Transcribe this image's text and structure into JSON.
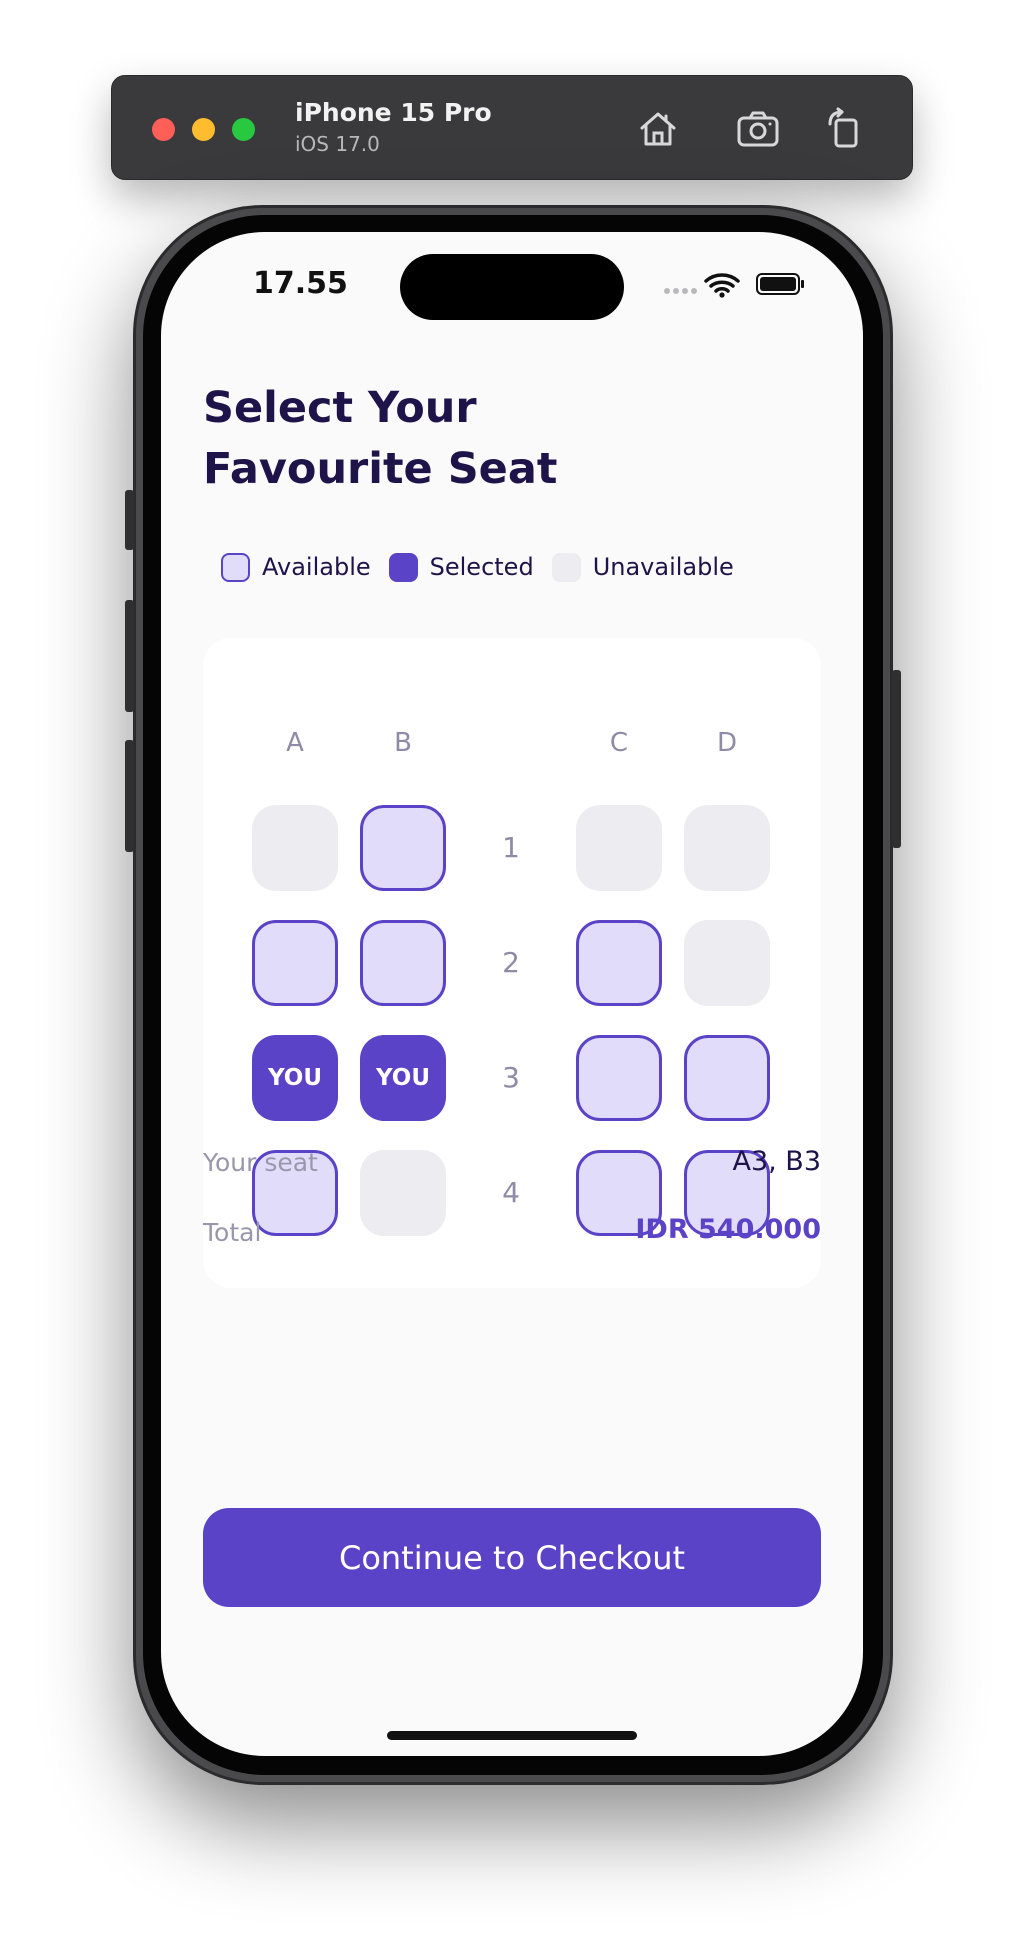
{
  "simulator": {
    "device_name": "iPhone 15 Pro",
    "os_version": "iOS 17.0",
    "buttons": [
      "home-icon",
      "screenshot-icon",
      "rotate-icon"
    ]
  },
  "status_bar": {
    "time": "17.55",
    "icons": [
      "cellular-dots-icon",
      "wifi-icon",
      "battery-icon"
    ]
  },
  "page": {
    "title_line1": "Select Your",
    "title_line2": "Favourite Seat"
  },
  "legend": {
    "available": "Available",
    "selected": "Selected",
    "unavailable": "Unavailable"
  },
  "seat_map": {
    "columns": [
      "A",
      "B",
      "C",
      "D"
    ],
    "rows": [
      {
        "label": "1",
        "seats": [
          "unavailable",
          "available",
          "unavailable",
          "unavailable"
        ]
      },
      {
        "label": "2",
        "seats": [
          "available",
          "available",
          "available",
          "unavailable"
        ]
      },
      {
        "label": "3",
        "seats": [
          "selected",
          "selected",
          "available",
          "available"
        ]
      },
      {
        "label": "4",
        "seats": [
          "available",
          "unavailable",
          "available",
          "available"
        ]
      }
    ],
    "selected_text": "YOU"
  },
  "summary": {
    "seat_label": "Your seat",
    "seat_value": "A3, B3",
    "total_label": "Total",
    "total_value": "IDR 540.000"
  },
  "checkout": {
    "label": "Continue to Checkout"
  },
  "colors": {
    "primary": "#5a43c6",
    "available_fill": "#e0dcfa",
    "unavailable_fill": "#ececf1",
    "title": "#1f1449"
  }
}
